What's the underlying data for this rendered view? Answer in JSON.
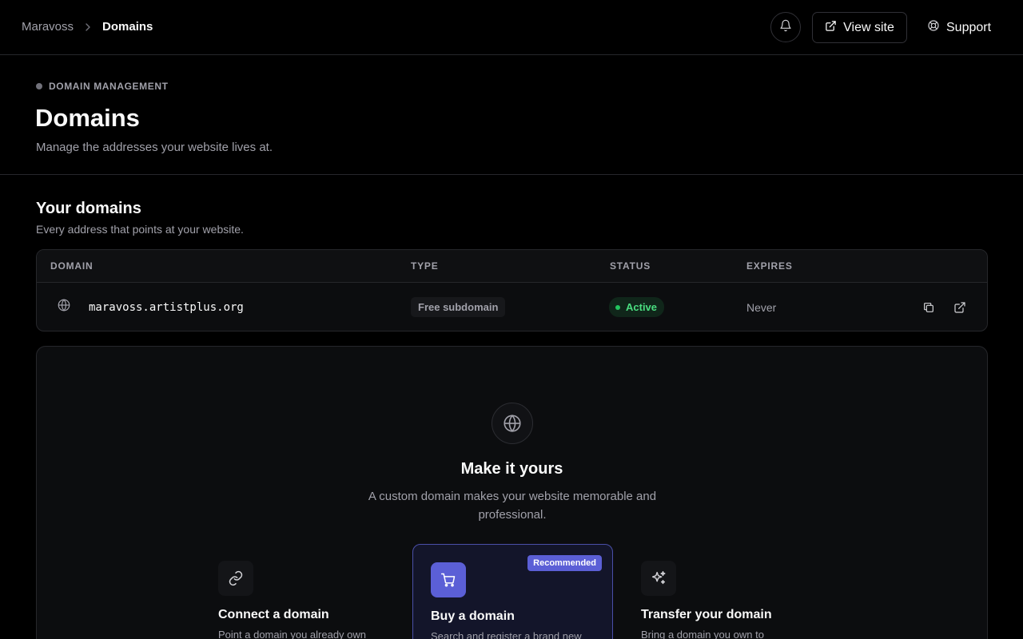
{
  "breadcrumb": {
    "root": "Maravoss",
    "current": "Domains"
  },
  "topbar": {
    "view_site_label": "View site",
    "support_label": "Support"
  },
  "header": {
    "eyebrow": "DOMAIN MANAGEMENT",
    "title": "Domains",
    "subtitle": "Manage the addresses your website lives at."
  },
  "section": {
    "title": "Your domains",
    "subtitle": "Every address that points at your website."
  },
  "table": {
    "columns": [
      "DOMAIN",
      "TYPE",
      "STATUS",
      "EXPIRES"
    ],
    "rows": [
      {
        "domain": "maravoss.artistplus.org",
        "type": "Free subdomain",
        "status": "Active",
        "expires": "Never"
      }
    ]
  },
  "cta": {
    "title": "Make it yours",
    "description": "A custom domain makes your website memorable and professional.",
    "options": [
      {
        "title": "Connect a domain",
        "description": "Point a domain you already own",
        "icon": "link-icon"
      },
      {
        "title": "Buy a domain",
        "description": "Search and register a brand new",
        "icon": "cart-icon",
        "badge": "Recommended"
      },
      {
        "title": "Transfer your domain",
        "description": "Bring a domain you own to",
        "icon": "sparkles-icon"
      }
    ]
  },
  "colors": {
    "accent": "#5b5fd6",
    "status_active": "#4ade80",
    "background": "#000000"
  }
}
